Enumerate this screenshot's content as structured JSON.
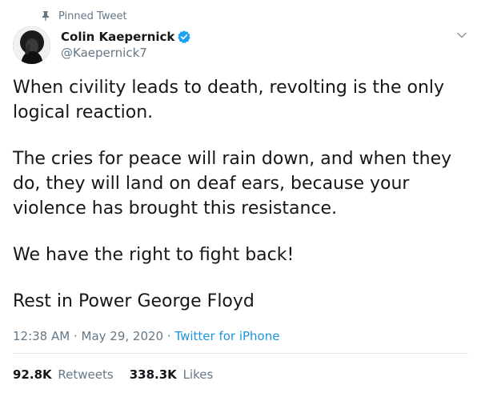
{
  "pinned_label": "Pinned Tweet",
  "author": {
    "name": "Colin Kaepernick",
    "handle": "@Kaepernick7",
    "verified": true
  },
  "tweet": {
    "paragraphs": [
      "When civility leads to death, revolting is the only logical reaction.",
      "The cries for peace will rain down, and when they do, they will land on deaf ears, because your violence has brought this resistance.",
      "We have the right to fight back!",
      "Rest in Power George Floyd"
    ]
  },
  "meta": {
    "time": "12:38 AM",
    "separator": " · ",
    "date": "May 29, 2020",
    "source": "Twitter for iPhone"
  },
  "stats": {
    "retweets_count": "92.8K",
    "retweets_label": "Retweets",
    "likes_count": "338.3K",
    "likes_label": "Likes"
  },
  "colors": {
    "text": "#14171a",
    "secondary": "#657786",
    "link": "#1b95e0",
    "verified": "#1da1f2"
  },
  "icons": {
    "pin": "pin-icon",
    "verified": "verified-badge-icon",
    "caret": "chevron-down-icon"
  }
}
